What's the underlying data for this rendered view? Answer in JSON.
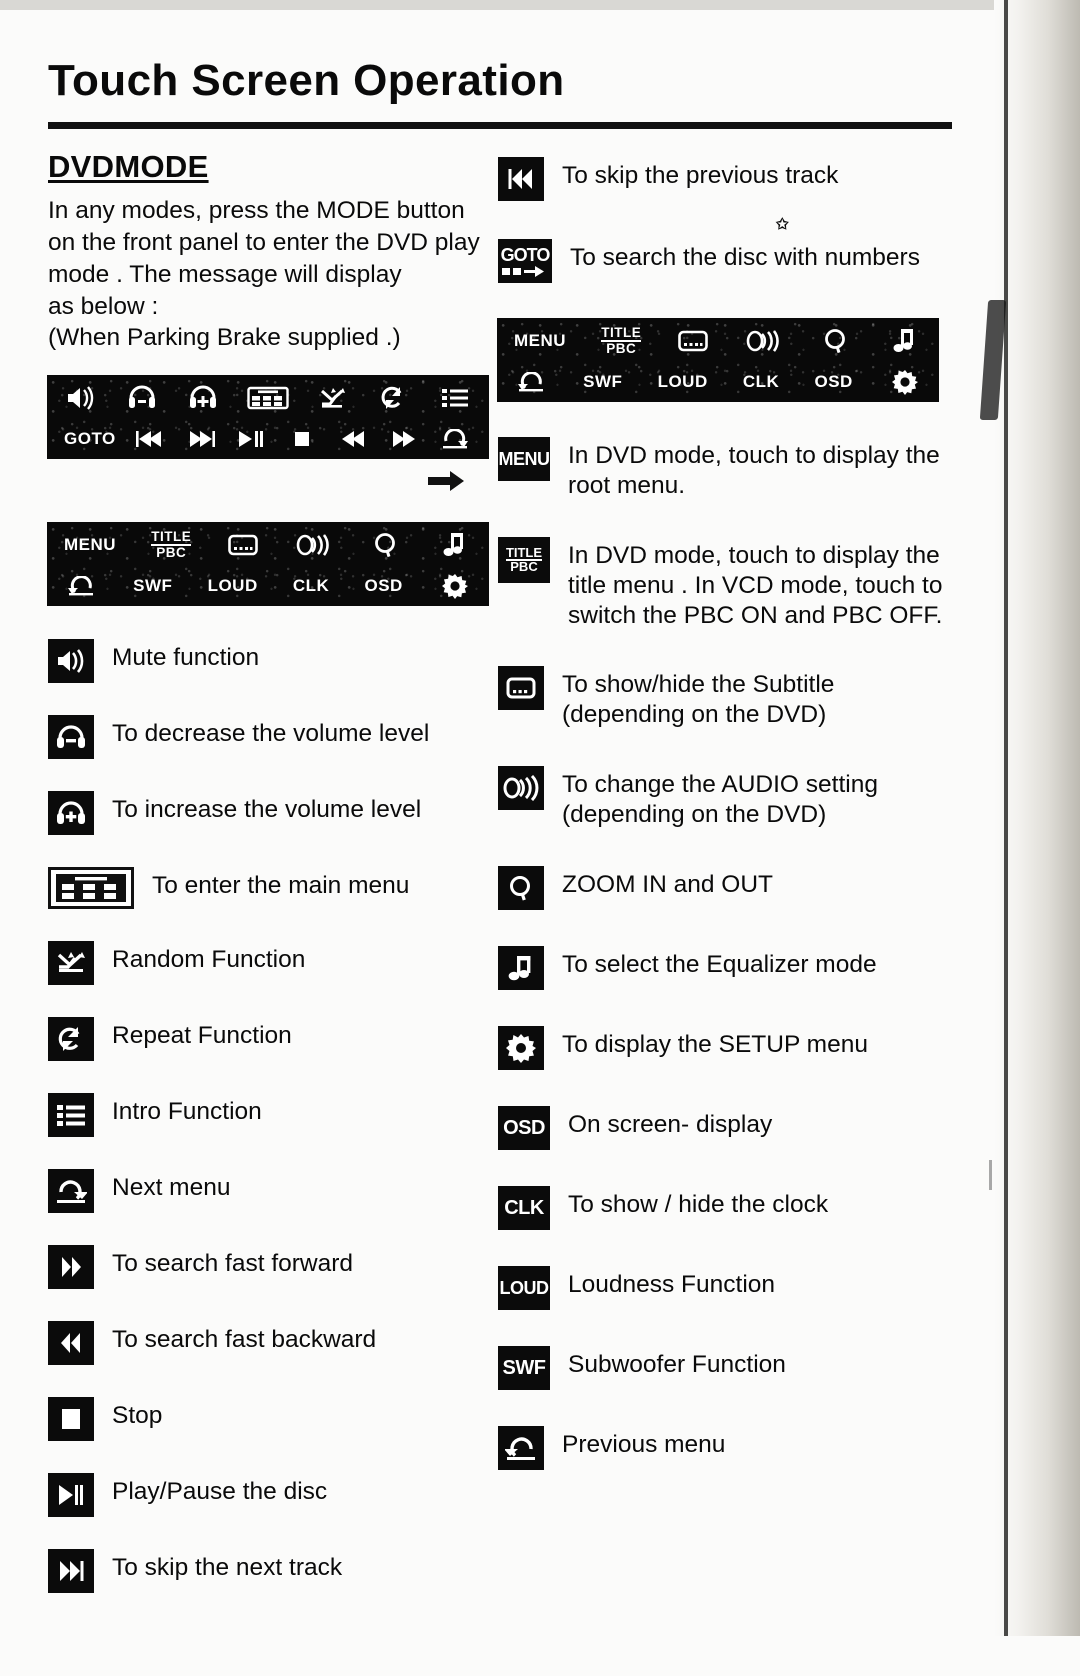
{
  "document": {
    "title": "Touch Screen Operation",
    "section_heading": "DVDMODE",
    "intro_lines": [
      "In any modes, press the MODE button",
      "on the front panel to enter the DVD play",
      "mode . The message will display",
      "as below :",
      "(When Parking Brake supplied .)"
    ]
  },
  "mockups": {
    "playback_bar": {
      "row1": [
        "mute-icon",
        "vol-down-icon",
        "vol-up-icon",
        "main-menu-icon",
        "random-icon",
        "repeat-icon",
        "intro-icon"
      ],
      "row2_labels": [
        "GOTO",
        "",
        "",
        "",
        "",
        "",
        "",
        ""
      ],
      "goto_label": "GOTO"
    },
    "menu_bar": {
      "row1": [
        "MENU",
        "TITLE",
        "PBC",
        "subtitle-icon",
        "audio-icon",
        "zoom-icon",
        "equalizer-icon"
      ],
      "row1_menu_label": "MENU",
      "row1_title_label": "TITLE",
      "row1_pbc_label": "PBC",
      "row2_labels": [
        "SWF",
        "LOUD",
        "CLK",
        "OSD"
      ]
    }
  },
  "left_column": [
    {
      "icon": "mute-icon",
      "chip_text": "",
      "lines": [
        "Mute function"
      ]
    },
    {
      "icon": "volume-down-icon",
      "chip_text": "",
      "lines": [
        "To decrease the volume level"
      ]
    },
    {
      "icon": "volume-up-icon",
      "chip_text": "",
      "lines": [
        "To increase the volume level"
      ]
    },
    {
      "icon": "main-menu-icon",
      "chip_text": "",
      "lines": [
        "To enter the main menu"
      ]
    },
    {
      "icon": "random-icon",
      "chip_text": "",
      "lines": [
        "Random Function"
      ]
    },
    {
      "icon": "repeat-icon",
      "chip_text": "",
      "lines": [
        "Repeat Function"
      ]
    },
    {
      "icon": "intro-icon",
      "chip_text": "",
      "lines": [
        "Intro Function"
      ]
    },
    {
      "icon": "next-menu-icon",
      "chip_text": "",
      "lines": [
        "Next menu"
      ]
    },
    {
      "icon": "fast-forward-icon",
      "chip_text": "",
      "lines": [
        "To search fast forward"
      ]
    },
    {
      "icon": "fast-backward-icon",
      "chip_text": "",
      "lines": [
        "To search fast backward"
      ]
    },
    {
      "icon": "stop-icon",
      "chip_text": "",
      "lines": [
        "Stop"
      ]
    },
    {
      "icon": "play-pause-icon",
      "chip_text": "",
      "lines": [
        "Play/Pause the disc"
      ]
    },
    {
      "icon": "next-track-icon",
      "chip_text": "",
      "lines": [
        "To skip the next track"
      ]
    }
  ],
  "right_column": [
    {
      "icon": "previous-track-icon",
      "chip_text": "",
      "lines": [
        "To skip the previous track"
      ]
    },
    {
      "icon": "goto-icon",
      "chip_text": "GOTO",
      "lines": [
        "To search the disc with numbers"
      ]
    },
    {
      "icon": "menu-icon",
      "chip_text": "MENU",
      "lines": [
        "In DVD mode, touch to display the",
        "root menu."
      ]
    },
    {
      "icon": "title-pbc-icon",
      "chip_text": "TITLE/PBC",
      "lines": [
        "In DVD mode, touch to display the",
        "title menu . In VCD mode, touch to",
        "switch the PBC ON and PBC OFF."
      ]
    },
    {
      "icon": "subtitle-icon",
      "chip_text": "",
      "lines": [
        "To show/hide the Subtitle",
        "(depending on the DVD)"
      ]
    },
    {
      "icon": "audio-icon",
      "chip_text": "",
      "lines": [
        "To change the AUDIO setting",
        "(depending on the DVD)"
      ]
    },
    {
      "icon": "zoom-icon",
      "chip_text": "",
      "lines": [
        "ZOOM IN and OUT"
      ]
    },
    {
      "icon": "equalizer-icon",
      "chip_text": "",
      "lines": [
        "To select the Equalizer mode"
      ]
    },
    {
      "icon": "setup-icon",
      "chip_text": "",
      "lines": [
        "To display the SETUP menu"
      ]
    },
    {
      "icon": "osd-icon",
      "chip_text": "OSD",
      "lines": [
        "On screen- display"
      ]
    },
    {
      "icon": "clk-icon",
      "chip_text": "CLK",
      "lines": [
        "To show / hide the clock"
      ]
    },
    {
      "icon": "loud-icon",
      "chip_text": "LOUD",
      "lines": [
        "Loudness Function"
      ]
    },
    {
      "icon": "swf-icon",
      "chip_text": "SWF",
      "lines": [
        "Subwoofer Function"
      ]
    },
    {
      "icon": "previous-menu-icon",
      "chip_text": "",
      "lines": [
        "Previous menu"
      ]
    }
  ],
  "colors": {
    "ink": "#0a0a0a",
    "paper": "#fbfbfa",
    "lcd_background": "#090909",
    "lcd_foreground": "#ffffff"
  }
}
